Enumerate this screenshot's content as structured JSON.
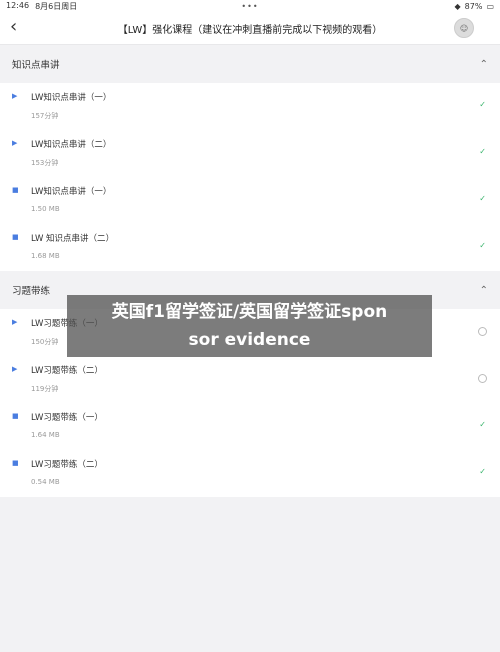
{
  "status": {
    "time": "12:46",
    "date": "8月6日周日",
    "battery": "87%",
    "signal": "◀ ⋯ ▮"
  },
  "nav": {
    "title": "【LW】强化课程（建议在冲刺直播前完成以下视频的观看）",
    "back": "‹",
    "dots": "•••"
  },
  "sections": [
    {
      "title": "知识点串讲",
      "items": [
        {
          "title": "LW知识点串讲（一）",
          "meta": "157分钟",
          "status": "done"
        },
        {
          "title": "LW知识点串讲（二）",
          "meta": "153分钟",
          "status": "done"
        },
        {
          "title": "LW知识点串讲（一）",
          "meta": "1.50 MB",
          "status": "done"
        },
        {
          "title": "LW 知识点串讲（二）",
          "meta": "1.68 MB",
          "status": "done"
        }
      ]
    },
    {
      "title": "习题带练",
      "items": [
        {
          "title": "LW习题带练（一）",
          "meta": "150分钟",
          "status": "todo"
        },
        {
          "title": "LW习题带练（二）",
          "meta": "119分钟",
          "status": "todo"
        },
        {
          "title": "LW习题带练（一）",
          "meta": "1.64 MB",
          "status": "done"
        },
        {
          "title": "LW习题带练（二）",
          "meta": "0.54 MB",
          "status": "done"
        }
      ]
    }
  ],
  "overlay": {
    "line1": "英国f1留学签证/英国留学签证spon",
    "line2": "sor evidence"
  }
}
